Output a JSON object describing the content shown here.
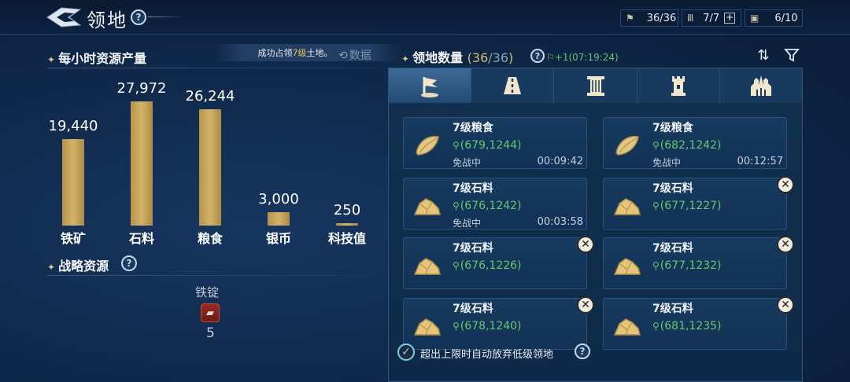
{
  "header": {
    "title": "领地",
    "stats": [
      {
        "icon": "flag-icon",
        "value": "36/36"
      },
      {
        "icon": "pillar-icon",
        "value": "7/7",
        "plus": "+"
      },
      {
        "icon": "city-icon",
        "value": "6/10"
      }
    ]
  },
  "production": {
    "title": "每小时资源产量",
    "notice_pre": "成功占领",
    "notice_level": "7级",
    "notice_post": "土地。",
    "data_button": "数据"
  },
  "chart_data": {
    "type": "bar",
    "title": "每小时资源产量",
    "categories": [
      "铁矿",
      "石料",
      "粮食",
      "银币",
      "科技值"
    ],
    "values": [
      19440,
      27972,
      26244,
      3000,
      250
    ],
    "value_labels": [
      "19,440",
      "27,972",
      "26,244",
      "3,000",
      "250"
    ],
    "ylim": [
      0,
      27972
    ],
    "grid": false,
    "legend": "none"
  },
  "strategic": {
    "title": "战略资源",
    "items": [
      {
        "name": "铁锭",
        "count": "5",
        "icon": "iron-ingot-icon"
      }
    ]
  },
  "territory": {
    "title": "领地数量",
    "current": "36",
    "max": "/36",
    "recover": "+1(07:19:24)",
    "tabs": [
      {
        "name": "tab-flag",
        "icon": "flag-icon",
        "active": true
      },
      {
        "name": "tab-road",
        "icon": "road-icon",
        "active": false
      },
      {
        "name": "tab-pillar",
        "icon": "pillar-icon",
        "active": false
      },
      {
        "name": "tab-tower",
        "icon": "tower-icon",
        "active": false
      },
      {
        "name": "tab-city",
        "icon": "city-icon",
        "active": false
      }
    ],
    "cards": [
      {
        "name": "7级粮食",
        "coord": "(679,1244)",
        "status": "免战中",
        "timer": "00:09:42",
        "type": "grain",
        "closable": false
      },
      {
        "name": "7级粮食",
        "coord": "(682,1242)",
        "status": "免战中",
        "timer": "00:12:57",
        "type": "grain",
        "closable": false
      },
      {
        "name": "7级石料",
        "coord": "(676,1242)",
        "status": "免战中",
        "timer": "00:03:58",
        "type": "stone",
        "closable": false
      },
      {
        "name": "7级石料",
        "coord": "(677,1227)",
        "status": "",
        "timer": "",
        "type": "stone",
        "closable": true
      },
      {
        "name": "7级石料",
        "coord": "(676,1226)",
        "status": "",
        "timer": "",
        "type": "stone",
        "closable": true
      },
      {
        "name": "7级石料",
        "coord": "(677,1232)",
        "status": "",
        "timer": "",
        "type": "stone",
        "closable": true
      },
      {
        "name": "7级石料",
        "coord": "(678,1240)",
        "status": "",
        "timer": "",
        "type": "stone",
        "closable": true
      },
      {
        "name": "7级石料",
        "coord": "(681,1235)",
        "status": "",
        "timer": "",
        "type": "stone",
        "closable": true
      }
    ],
    "auto_abandon": "超出上限时自动放弃低级领地",
    "auto_checked": true
  },
  "colors": {
    "bar": "#c9a95d",
    "coord": "#67c86f",
    "accent_gold": "#d8b76e",
    "background": "#0f2748"
  }
}
